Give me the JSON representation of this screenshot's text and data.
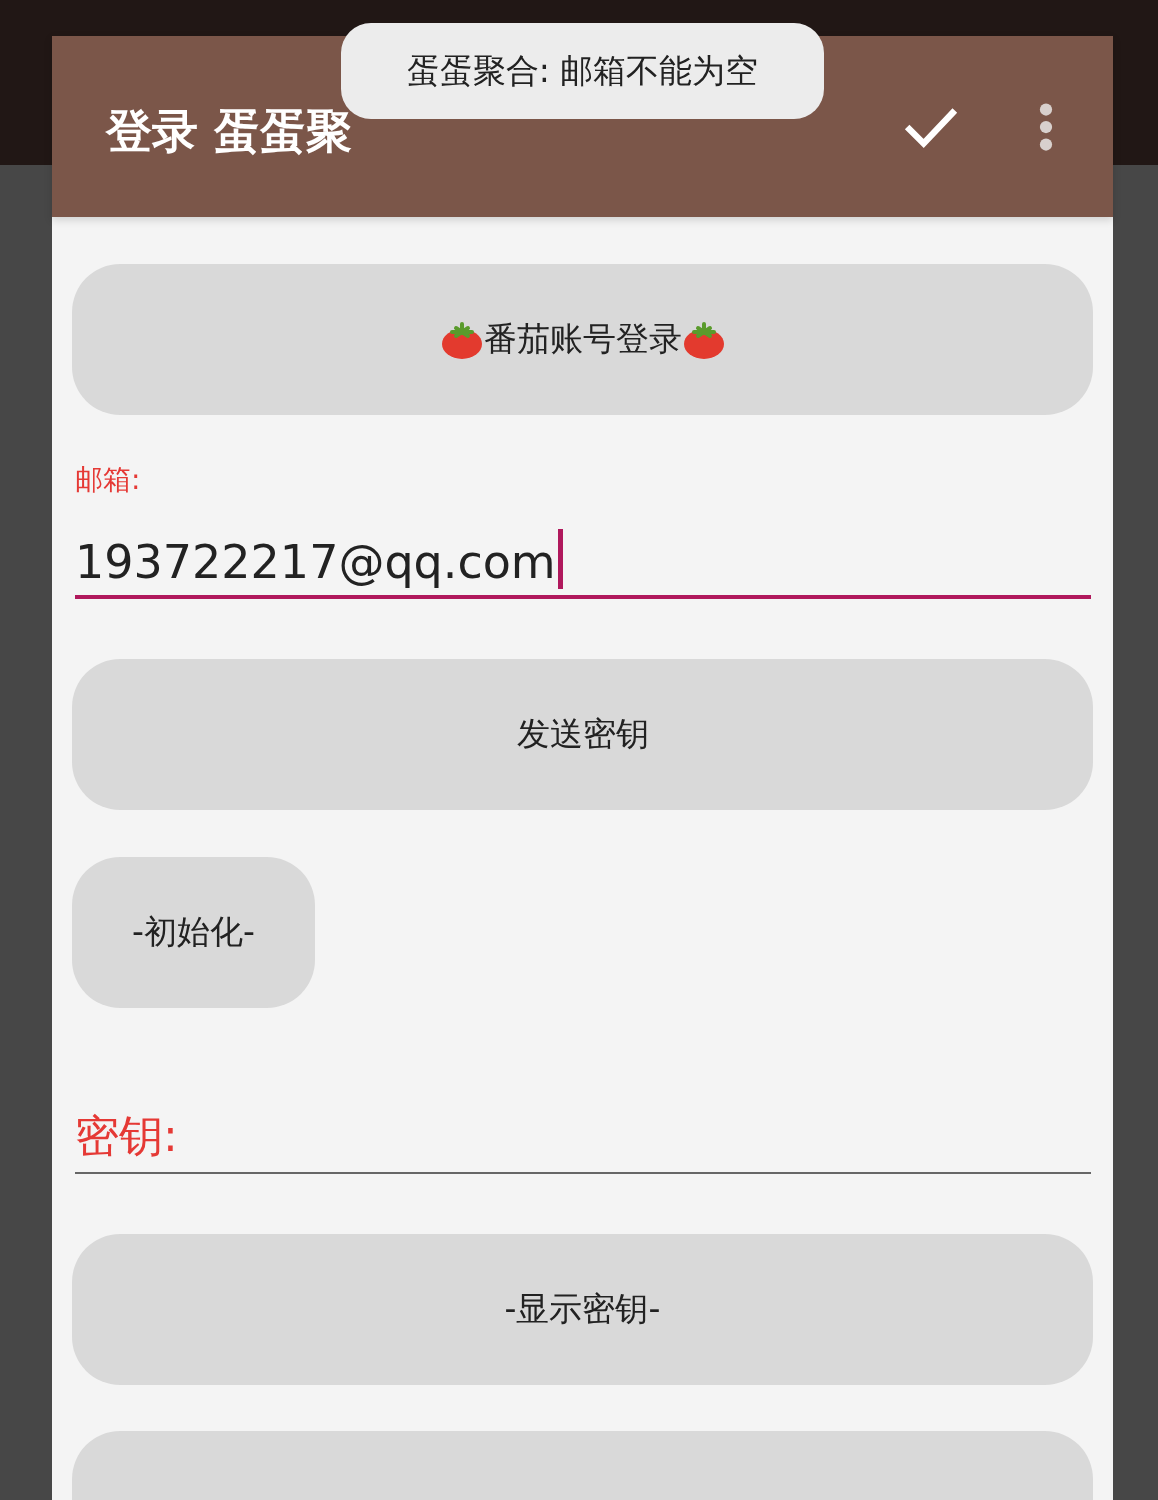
{
  "toolbar": {
    "title": "登录 蛋蛋聚"
  },
  "toast": {
    "text": "蛋蛋聚合: 邮箱不能为空"
  },
  "items": [
    {
      "kind": "button",
      "label": "番茄账号登录",
      "tomatoes": true,
      "wide": true
    },
    {
      "kind": "field",
      "label": "邮箱:",
      "value": "193722217@qq.com",
      "focused": true
    },
    {
      "kind": "button",
      "label": "发送密钥",
      "tomatoes": false,
      "wide": true
    },
    {
      "kind": "button",
      "label": "-初始化-",
      "tomatoes": false,
      "wide": false
    },
    {
      "kind": "field",
      "placeholder": "密钥:",
      "focused": false
    },
    {
      "kind": "button",
      "label": "-显示密钥-",
      "tomatoes": false,
      "wide": true
    },
    {
      "kind": "button",
      "tomatoes": false,
      "wide": true
    }
  ]
}
